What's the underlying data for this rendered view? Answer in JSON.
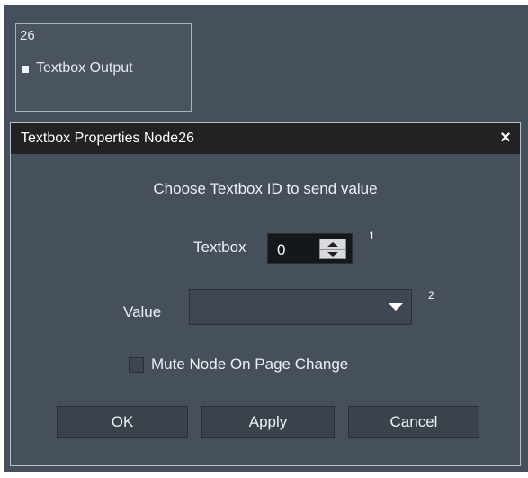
{
  "node": {
    "id": "26",
    "label": "Textbox Output"
  },
  "dialog": {
    "title": "Textbox Properties Node26",
    "close_label": "×",
    "heading": "Choose Textbox ID to send value",
    "textbox": {
      "label": "Textbox",
      "value": "0",
      "note": "1"
    },
    "value_field": {
      "label": "Value",
      "selected": "",
      "note": "2"
    },
    "mute_checkbox": {
      "label": "Mute Node On Page Change",
      "checked": false
    },
    "buttons": {
      "ok": "OK",
      "apply": "Apply",
      "cancel": "Cancel"
    }
  },
  "colors": {
    "canvas_bg": "#46505d",
    "titlebar_bg": "#202224",
    "input_bg": "#15181b"
  },
  "icons": {
    "node_port": "square-port-icon",
    "close": "close-icon",
    "spin_up": "spin-up-icon",
    "spin_down": "spin-down-icon",
    "dropdown": "dropdown-arrow-icon"
  }
}
